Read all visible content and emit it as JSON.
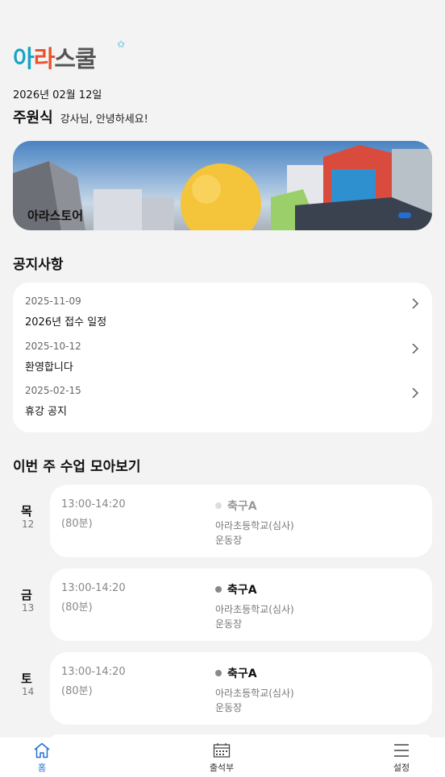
{
  "header": {
    "logo_text": "아라스쿨",
    "logo_colors": [
      "#17a3c6",
      "#e8542d",
      "#17a3c6",
      "#555555",
      "#555555"
    ],
    "date": "2026년 02월 12일",
    "user_name": "주원식",
    "greeting": "강사님, 안녕하세요!"
  },
  "banner": {
    "caption": "아라스토어",
    "indicator_color": "#1e6fd9"
  },
  "notices": {
    "title": "공지사항",
    "items": [
      {
        "date": "2025-11-09",
        "title": "2026년 접수 일정"
      },
      {
        "date": "2025-10-12",
        "title": "환영합니다"
      },
      {
        "date": "2025-02-15",
        "title": "휴강 공지"
      }
    ]
  },
  "weekly": {
    "title": "이번 주 수업 모아보기",
    "days": [
      {
        "day": "목",
        "date": "12",
        "time": "13:00-14:20",
        "duration": "(80분)",
        "class_name": "축구A",
        "school": "아라초등학교(심사)",
        "place": "운동장",
        "dot_color": "#dddddd",
        "name_color": "#999999"
      },
      {
        "day": "금",
        "date": "13",
        "time": "13:00-14:20",
        "duration": "(80분)",
        "class_name": "축구A",
        "school": "아라초등학교(심사)",
        "place": "운동장",
        "dot_color": "#888888",
        "name_color": "#111111"
      },
      {
        "day": "토",
        "date": "14",
        "time": "13:00-14:20",
        "duration": "(80분)",
        "class_name": "축구A",
        "school": "아라초등학교(심사)",
        "place": "운동장",
        "dot_color": "#888888",
        "name_color": "#111111"
      }
    ]
  },
  "nav": {
    "items": [
      {
        "label": "홈",
        "icon": "home-icon",
        "active": true
      },
      {
        "label": "출석부",
        "icon": "calendar-icon",
        "active": false
      },
      {
        "label": "설정",
        "icon": "menu-icon",
        "active": false
      }
    ],
    "active_color": "#1e6fd9"
  }
}
